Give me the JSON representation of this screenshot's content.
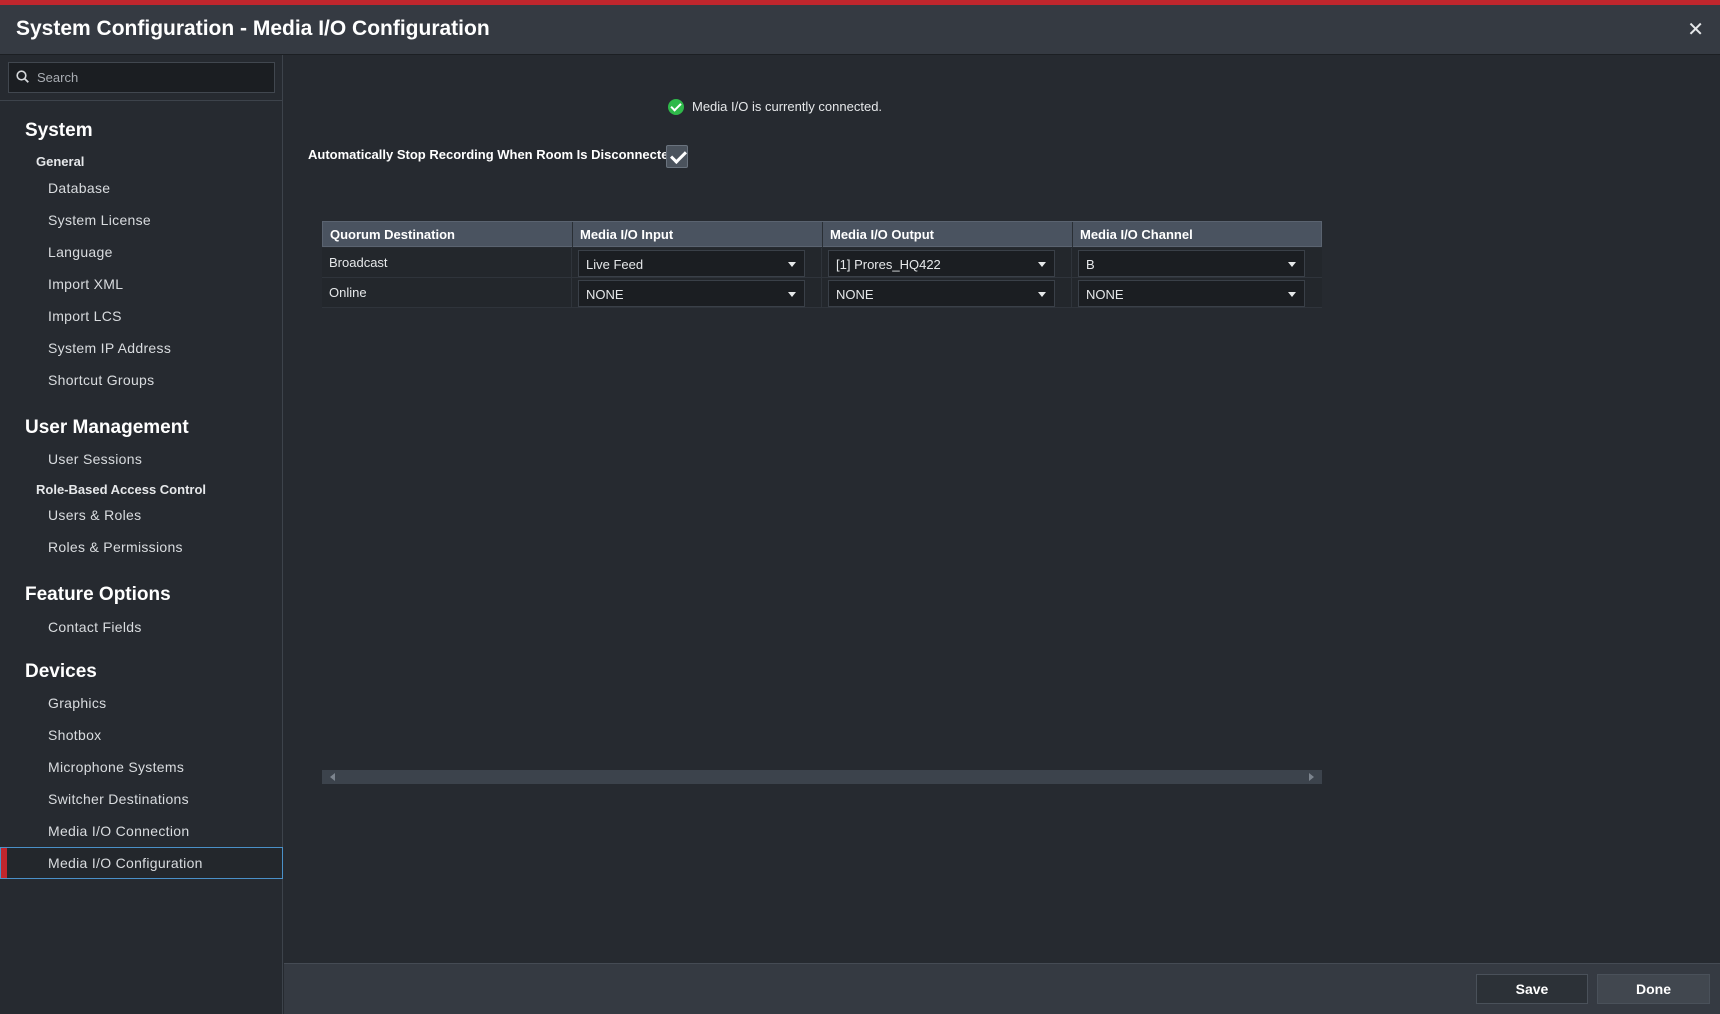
{
  "window": {
    "title": "System Configuration - Media I/O Configuration",
    "close_label": "✕"
  },
  "sidebar": {
    "search_placeholder": "Search",
    "sections": [
      {
        "heading": "System",
        "subheading": "General",
        "items": [
          "Database",
          "System License",
          "Language",
          "Import XML",
          "Import LCS",
          "System IP Address",
          "Shortcut Groups"
        ]
      },
      {
        "heading": "User Management",
        "items_before": [
          "User Sessions"
        ],
        "subheading": "Role-Based Access Control",
        "items": [
          "Users & Roles",
          "Roles & Permissions"
        ]
      },
      {
        "heading": "Feature Options",
        "items": [
          "Contact Fields"
        ]
      },
      {
        "heading": "Devices",
        "items": [
          "Graphics",
          "Shotbox",
          "Microphone Systems",
          "Switcher Destinations",
          "Media I/O Connection",
          "Media I/O Configuration"
        ]
      }
    ],
    "active_item": "Media I/O Configuration"
  },
  "main": {
    "status_text": "Media I/O is currently connected.",
    "auto_stop_label": "Automatically Stop Recording When Room Is Disconnected",
    "auto_stop_checked": true,
    "table": {
      "columns": [
        "Quorum Destination",
        "Media I/O Input",
        "Media I/O Output",
        "Media I/O Channel"
      ],
      "rows": [
        {
          "destination": "Broadcast",
          "input": "Live Feed",
          "output": "[1] Prores_HQ422",
          "channel": "B"
        },
        {
          "destination": "Online",
          "input": "NONE",
          "output": "NONE",
          "channel": "NONE"
        }
      ]
    }
  },
  "footer": {
    "save_label": "Save",
    "done_label": "Done"
  },
  "colors": {
    "accent": "#c0262d",
    "success": "#2fb94a",
    "selection_border": "#4a90c8"
  }
}
